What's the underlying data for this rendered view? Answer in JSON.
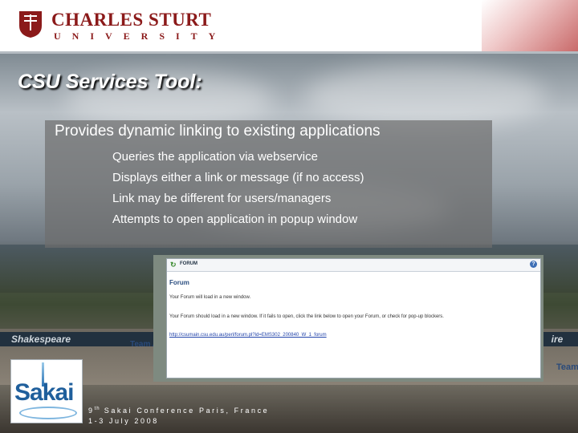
{
  "header": {
    "brand_main": "CHARLES STURT",
    "brand_sub": "UNIVERSITY"
  },
  "slide": {
    "title": "CSU Services Tool:",
    "main_point": "Provides dynamic linking to existing applications",
    "sub_points": [
      "Queries the application via webservice",
      "Displays either a link or message (if no access)",
      "Link may be different for users/managers",
      "Attempts to open application in popup window"
    ]
  },
  "background": {
    "banner_left": "Shakespeare",
    "team_label": "Team",
    "team_label_left": "Team Aus"
  },
  "screenshot": {
    "bar_title": "FORUM",
    "heading": "Forum",
    "line1": "Your Forum will load in a new window.",
    "line2": "Your Forum should load in a new window. If it fails to open, click the link below to open your Forum, or check for pop-up blockers.",
    "link": "http://csumain.csu.edu.au/perl/forum.pl?id=EMS302_200840_W_1_forum",
    "help_glyph": "?"
  },
  "logo": {
    "name": "Sakai"
  },
  "footer": {
    "ordinal_num": "9",
    "ordinal_suffix": "th",
    "line1_rest": " Sakai Conference Paris, France",
    "line2": "1-3 July 2008"
  },
  "colors": {
    "brand_red": "#8b1a1a",
    "title_white": "#ffffff",
    "sakai_blue": "#1f5f9c"
  }
}
